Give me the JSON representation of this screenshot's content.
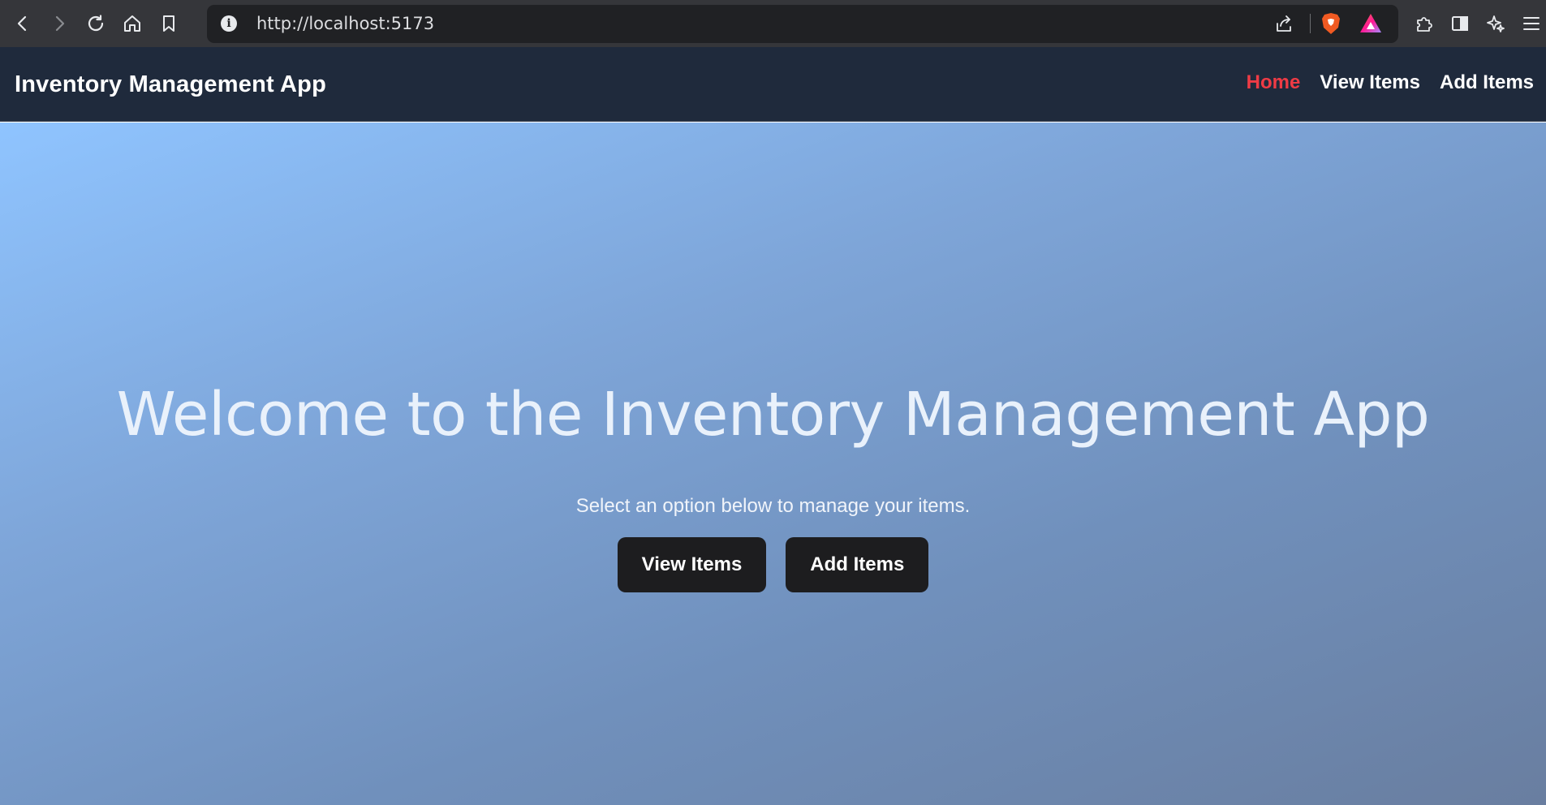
{
  "browser": {
    "url": "http://localhost:5173",
    "info_glyph": "i",
    "icons": {
      "back": "back-arrow-icon",
      "forward": "forward-arrow-icon",
      "reload": "reload-icon",
      "home": "home-icon",
      "bookmark": "bookmark-icon",
      "share": "share-icon",
      "brave": "brave-shield-icon",
      "rewards": "brave-rewards-icon",
      "extensions": "extensions-icon",
      "sidebar": "sidebar-icon",
      "leo": "leo-ai-icon",
      "menu": "menu-icon"
    }
  },
  "navbar": {
    "brand": "Inventory Management App",
    "links": [
      {
        "label": "Home",
        "active": true
      },
      {
        "label": "View Items",
        "active": false
      },
      {
        "label": "Add Items",
        "active": false
      }
    ]
  },
  "hero": {
    "title": "Welcome to the Inventory Management App",
    "subtitle": "Select an option below to manage your items.",
    "buttons": [
      {
        "label": "View Items"
      },
      {
        "label": "Add Items"
      }
    ]
  },
  "colors": {
    "navbar_bg": "#1f2a3c",
    "active_link": "#ef3b45",
    "button_bg": "#1d1d1f",
    "hero_gradient_start": "#8fc4ff",
    "hero_gradient_end": "#697ea0"
  }
}
